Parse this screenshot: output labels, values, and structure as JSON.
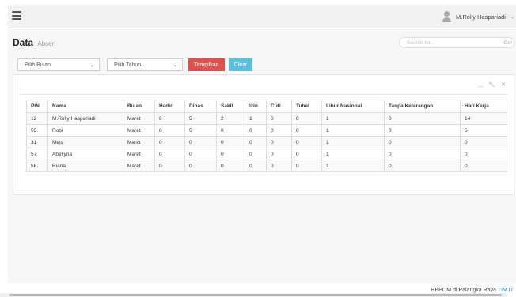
{
  "header": {
    "user_name": "M.Rolly Haspariadi",
    "caret": "⌄"
  },
  "page": {
    "title": "Data",
    "subtitle": "Absen"
  },
  "search": {
    "placeholder": "Search for...",
    "button_label": "Go!"
  },
  "filters": {
    "month_value": "Pilih Bulan",
    "year_value": "Pilih Tahun",
    "chevron": "⌄",
    "show_label": "Tampilkan",
    "clear_label": "Clear"
  },
  "panel_tools": {
    "collapse": "︿",
    "wrench": "🔧",
    "close": "✕"
  },
  "table": {
    "columns": [
      "PIN",
      "Nama",
      "Bulan",
      "Hadir",
      "Dinas",
      "Sakit",
      "Izin",
      "Cuti",
      "Tubel",
      "Libur Nasional",
      "Tanpa Keterangan",
      "Hari Kerja"
    ],
    "rows": [
      [
        "12",
        "M.Rolly Haspariadi",
        "Maret",
        "6",
        "5",
        "2",
        "1",
        "0",
        "0",
        "1",
        "0",
        "14"
      ],
      [
        "55",
        "Robi",
        "Maret",
        "0",
        "5",
        "0",
        "0",
        "0",
        "0",
        "1",
        "0",
        "5"
      ],
      [
        "31",
        "Meta",
        "Maret",
        "0",
        "0",
        "0",
        "0",
        "0",
        "0",
        "1",
        "0",
        "0"
      ],
      [
        "57",
        "Abellyna",
        "Maret",
        "0",
        "0",
        "0",
        "0",
        "0",
        "0",
        "1",
        "0",
        "0"
      ],
      [
        "56",
        "Riana",
        "Maret",
        "0",
        "0",
        "0",
        "0",
        "0",
        "0",
        "1",
        "0",
        "0"
      ]
    ]
  },
  "footer": {
    "text": "BBPOM di Palangka Raya",
    "brand": "TIM IT"
  }
}
